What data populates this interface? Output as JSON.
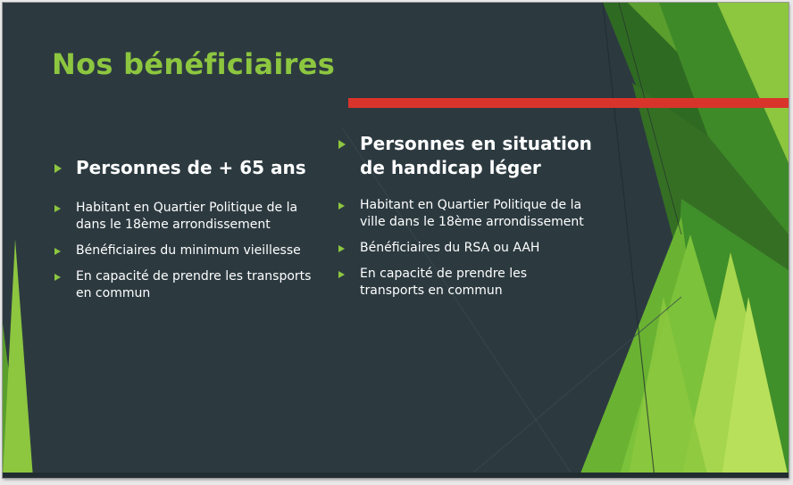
{
  "slide": {
    "title": "Nos bénéficiaires",
    "colors": {
      "background": "#2c3a40",
      "accent": "#8dc63f",
      "bar": "#d9342b",
      "text": "#ffffff"
    },
    "bullet_icon": "triangle-right-icon",
    "left": {
      "heading": "Personnes de + 65 ans",
      "items": [
        "Habitant en Quartier Politique de la dans le 18ème arrondissement",
        "Bénéficiaires du minimum vieillesse",
        "En capacité de prendre les transports en commun"
      ]
    },
    "right": {
      "heading": "Personnes en situation de handicap léger",
      "items": [
        "Habitant en Quartier Politique de la ville dans le 18ème arrondissement",
        "Bénéficiaires du RSA ou AAH",
        "En capacité de prendre les transports en commun"
      ]
    }
  }
}
